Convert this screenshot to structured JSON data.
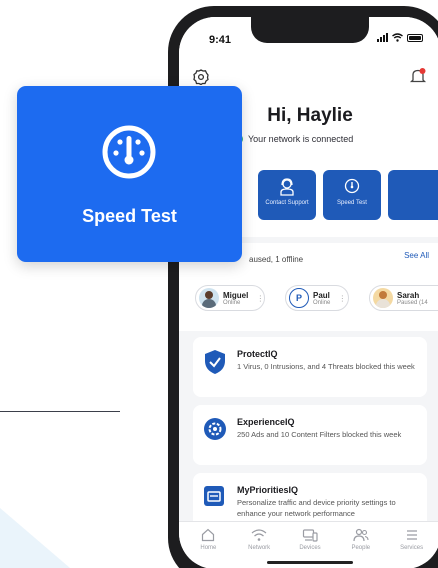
{
  "status_bar": {
    "time": "9:41"
  },
  "header": {
    "greeting": "Hi, Haylie",
    "connection_status": "Your network is connected"
  },
  "quick_actions": [
    {
      "label": "",
      "icon": "partial-icon"
    },
    {
      "label": "Contact Support",
      "icon": "support-agent-icon"
    },
    {
      "label": "Speed Test",
      "icon": "speedometer-icon"
    },
    {
      "label": "",
      "icon": "partial-icon"
    }
  ],
  "people": {
    "status_summary": "aused, 1 offline",
    "see_all": "See All",
    "items": [
      {
        "name": "Miguel",
        "status": "Online",
        "avatar": "photo"
      },
      {
        "name": "Paul",
        "status": "Online",
        "avatar": "P"
      },
      {
        "name": "Sarah",
        "status": "Paused (14",
        "avatar": "photo"
      }
    ]
  },
  "features": [
    {
      "title": "ProtectIQ",
      "description": "1 Virus, 0 Intrusions, and 4 Threats blocked this week",
      "icon": "shield-icon"
    },
    {
      "title": "ExperienceIQ",
      "description": "250 Ads and 10 Content Filters blocked this week",
      "icon": "people-gear-icon"
    },
    {
      "title": "MyPrioritiesIQ",
      "description": "Personalize traffic and device priority settings to enhance your network performance",
      "icon": "priority-icon"
    }
  ],
  "nav": [
    {
      "label": "Home",
      "icon": "home-icon"
    },
    {
      "label": "Network",
      "icon": "wifi-icon"
    },
    {
      "label": "Devices",
      "icon": "devices-icon"
    },
    {
      "label": "People",
      "icon": "people-icon"
    },
    {
      "label": "Services",
      "icon": "list-icon"
    }
  ],
  "highlight_card": {
    "label": "Speed Test",
    "icon": "speedometer-icon"
  },
  "colors": {
    "brand_blue": "#1d6bf0",
    "tile_blue": "#1f5ab8",
    "connected_green": "#33b27a",
    "notification_red": "#e53935"
  }
}
